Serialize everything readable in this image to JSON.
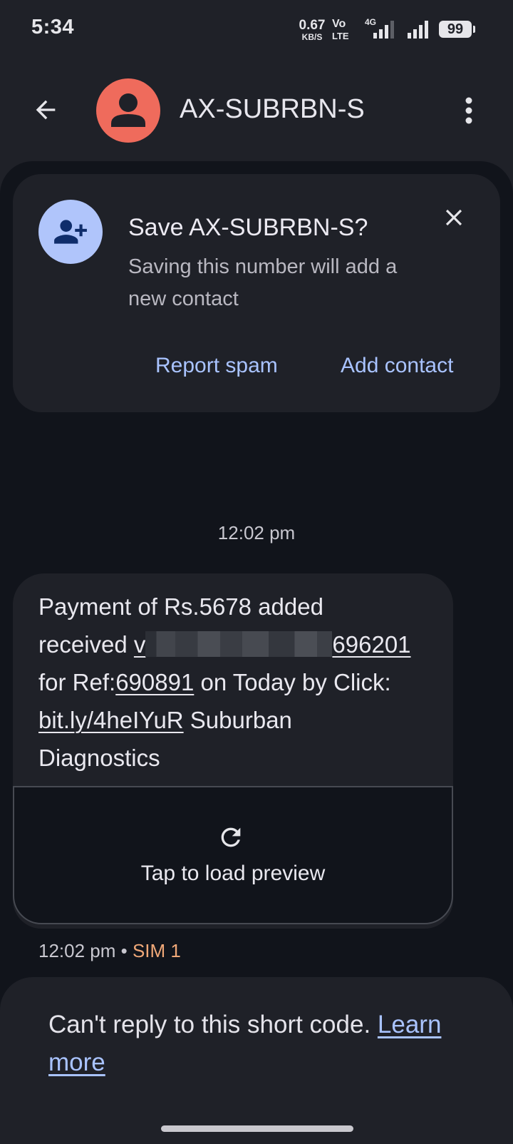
{
  "status_bar": {
    "time": "5:34",
    "net_speed": "0.67",
    "net_speed_unit": "KB/S",
    "volte_top": "Vo",
    "volte_bottom": "LTE",
    "network": "4G",
    "battery": "99"
  },
  "header": {
    "title": "AX-SUBRBN-S",
    "avatar_color": "#ef6b5c"
  },
  "save_card": {
    "title": "Save AX-SUBRBN-S?",
    "subtitle": "Saving this number will add a new contact",
    "report_spam_label": "Report spam",
    "add_contact_label": "Add contact"
  },
  "conversation": {
    "timestamp": "12:02 pm",
    "message": {
      "line1": "Payment of Rs.5678 added",
      "line2_prefix": "received ",
      "line2_link_start": "v",
      "line2_link_end": "696201",
      "line3_prefix": "for Ref:",
      "line3_ref": "690891",
      "line3_suffix": " on Today by Click:",
      "line4_link": "bit.ly/4heIYuR",
      "line4_suffix": " Suburban",
      "line5": "Diagnostics"
    },
    "preview_label": "Tap to load preview",
    "meta_time": "12:02 pm",
    "meta_separator": " • ",
    "meta_sim": "SIM 1"
  },
  "reply_notice": {
    "text": "Can't reply to this short code. ",
    "learn_more": "Learn more"
  },
  "colors": {
    "background": "#1f2128",
    "conversation_bg": "#11141b",
    "accent_link": "#a9c3ff",
    "sim_label": "#f0a878"
  }
}
